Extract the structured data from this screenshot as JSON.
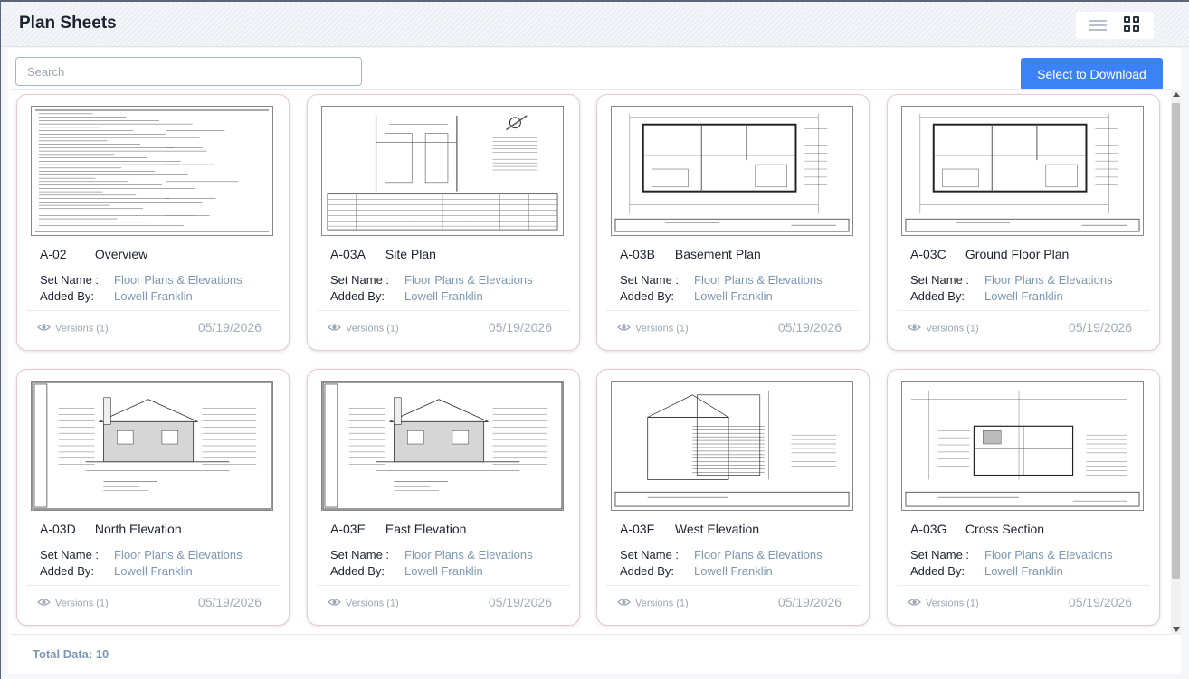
{
  "header": {
    "title": "Plan Sheets",
    "view_toggle": {
      "list_icon": "list-view-icon",
      "grid_icon": "grid-view-icon",
      "active": "grid"
    }
  },
  "toolbar": {
    "search_placeholder": "Search",
    "search_value": "",
    "download_label": "Select to Download",
    "accent_color": "#3b82f6"
  },
  "labels": {
    "set_name": "Set Name :",
    "added_by": "Added By:"
  },
  "sheets": [
    {
      "number": "A-02",
      "title": "Overview",
      "set_name": "Floor Plans & Elevations",
      "added_by": "Lowell Franklin",
      "versions": "Versions (1)",
      "date": "05/19/2026",
      "thumb": "text"
    },
    {
      "number": "A-03A",
      "title": "Site Plan",
      "set_name": "Floor Plans & Elevations",
      "added_by": "Lowell Franklin",
      "versions": "Versions (1)",
      "date": "05/19/2026",
      "thumb": "site"
    },
    {
      "number": "A-03B",
      "title": "Basement Plan",
      "set_name": "Floor Plans & Elevations",
      "added_by": "Lowell Franklin",
      "versions": "Versions (1)",
      "date": "05/19/2026",
      "thumb": "plan"
    },
    {
      "number": "A-03C",
      "title": "Ground Floor Plan",
      "set_name": "Floor Plans & Elevations",
      "added_by": "Lowell Franklin",
      "versions": "Versions (1)",
      "date": "05/19/2026",
      "thumb": "plan"
    },
    {
      "number": "A-03D",
      "title": "North Elevation",
      "set_name": "Floor Plans & Elevations",
      "added_by": "Lowell Franklin",
      "versions": "Versions (1)",
      "date": "05/19/2026",
      "thumb": "elevation"
    },
    {
      "number": "A-03E",
      "title": "East Elevation",
      "set_name": "Floor Plans & Elevations",
      "added_by": "Lowell Franklin",
      "versions": "Versions (1)",
      "date": "05/19/2026",
      "thumb": "elevation"
    },
    {
      "number": "A-03F",
      "title": "West Elevation",
      "set_name": "Floor Plans & Elevations",
      "added_by": "Lowell Franklin",
      "versions": "Versions (1)",
      "date": "05/19/2026",
      "thumb": "west"
    },
    {
      "number": "A-03G",
      "title": "Cross Section",
      "set_name": "Floor Plans & Elevations",
      "added_by": "Lowell Franklin",
      "versions": "Versions (1)",
      "date": "05/19/2026",
      "thumb": "section"
    }
  ],
  "footer": {
    "total": "Total Data: 10"
  }
}
